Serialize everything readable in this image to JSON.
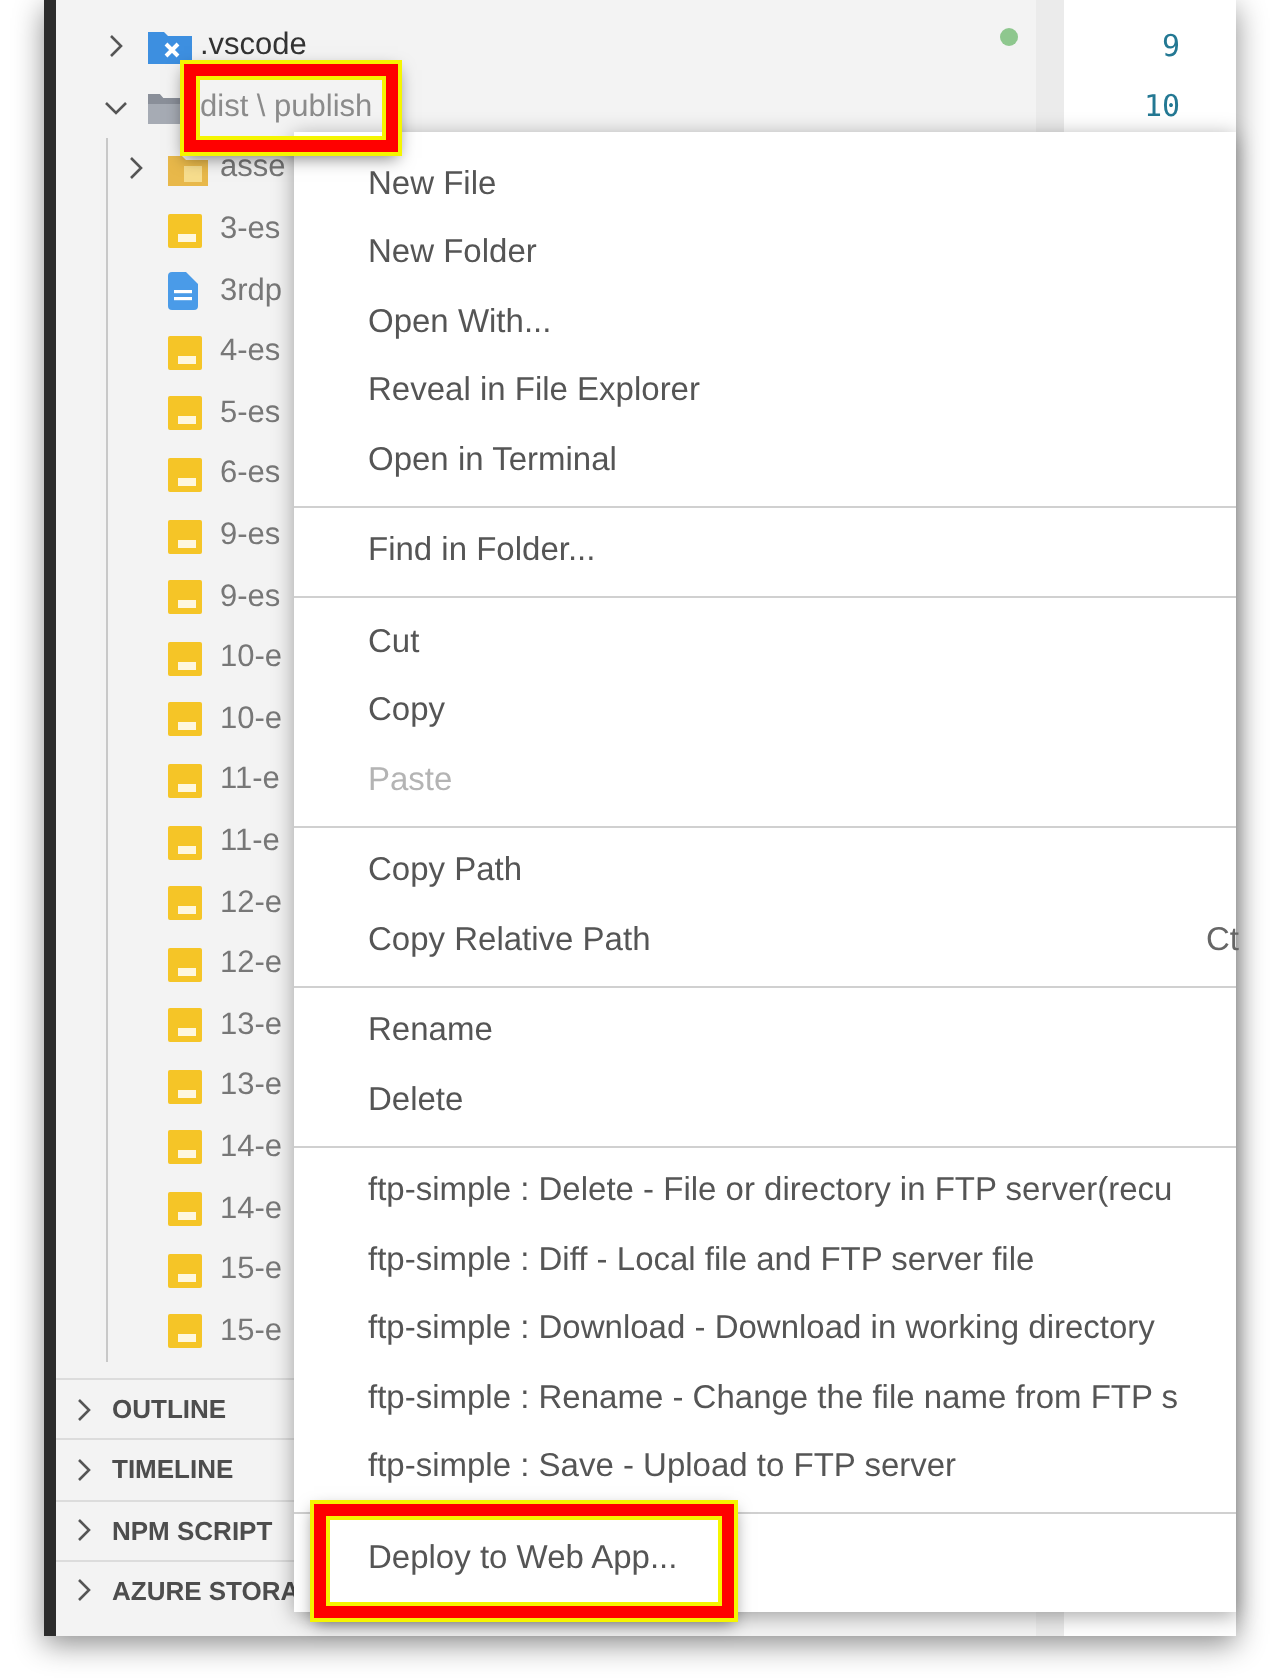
{
  "explorer": {
    "tree": [
      {
        "name": ".vscode",
        "kind": "vscode-folder",
        "expanded": false,
        "modified": true,
        "highlighted": false
      },
      {
        "name": "dist \\ publish",
        "kind": "folder",
        "expanded": true,
        "modified": false,
        "highlighted": true,
        "children": [
          {
            "name": "asse",
            "kind": "assets-folder",
            "expanded": false,
            "highlighted": false
          },
          {
            "name": "3-es",
            "kind": "js",
            "highlighted": false
          },
          {
            "name": "3rdp",
            "kind": "doc",
            "highlighted": false
          },
          {
            "name": "4-es",
            "kind": "js",
            "highlighted": false
          },
          {
            "name": "5-es",
            "kind": "js",
            "highlighted": false
          },
          {
            "name": "6-es",
            "kind": "js",
            "highlighted": false
          },
          {
            "name": "9-es",
            "kind": "js",
            "highlighted": false
          },
          {
            "name": "9-es",
            "kind": "js",
            "highlighted": false
          },
          {
            "name": "10-e",
            "kind": "js",
            "highlighted": false
          },
          {
            "name": "10-e",
            "kind": "js",
            "highlighted": false
          },
          {
            "name": "11-e",
            "kind": "js",
            "highlighted": false
          },
          {
            "name": "11-e",
            "kind": "js",
            "highlighted": false
          },
          {
            "name": "12-e",
            "kind": "js",
            "highlighted": false
          },
          {
            "name": "12-e",
            "kind": "js",
            "highlighted": false
          },
          {
            "name": "13-e",
            "kind": "js",
            "highlighted": false
          },
          {
            "name": "13-e",
            "kind": "js",
            "highlighted": false
          },
          {
            "name": "14-e",
            "kind": "js",
            "highlighted": false
          },
          {
            "name": "14-e",
            "kind": "js",
            "highlighted": false
          },
          {
            "name": "15-e",
            "kind": "js",
            "highlighted": false
          },
          {
            "name": "15-e",
            "kind": "js",
            "highlighted": false
          }
        ]
      }
    ]
  },
  "panels": [
    {
      "title": "OUTLINE",
      "expanded": false
    },
    {
      "title": "TIMELINE",
      "expanded": false
    },
    {
      "title": "NPM SCRIPT",
      "expanded": false
    },
    {
      "title": "AZURE STORA",
      "expanded": false
    }
  ],
  "editor": {
    "line_numbers": [
      "9",
      "10"
    ]
  },
  "context_menu": {
    "groups": [
      [
        {
          "label": "New File",
          "disabled": false,
          "highlighted": false
        },
        {
          "label": "New Folder",
          "disabled": false,
          "highlighted": false
        },
        {
          "label": "Open With...",
          "disabled": false,
          "highlighted": false
        },
        {
          "label": "Reveal in File Explorer",
          "disabled": false,
          "highlighted": false
        },
        {
          "label": "Open in Terminal",
          "disabled": false,
          "highlighted": false
        }
      ],
      [
        {
          "label": "Find in Folder...",
          "disabled": false,
          "highlighted": false
        }
      ],
      [
        {
          "label": "Cut",
          "disabled": false,
          "highlighted": false
        },
        {
          "label": "Copy",
          "disabled": false,
          "highlighted": false
        },
        {
          "label": "Paste",
          "disabled": true,
          "highlighted": false
        }
      ],
      [
        {
          "label": "Copy Path",
          "disabled": false,
          "highlighted": false
        },
        {
          "label": "Copy Relative Path",
          "shortcut": "Ct",
          "disabled": false,
          "highlighted": false
        }
      ],
      [
        {
          "label": "Rename",
          "disabled": false,
          "highlighted": false
        },
        {
          "label": "Delete",
          "disabled": false,
          "highlighted": false
        }
      ],
      [
        {
          "label": "ftp-simple : Delete - File or directory in FTP server(recu",
          "disabled": false,
          "highlighted": false
        },
        {
          "label": "ftp-simple : Diff - Local file and FTP server file",
          "disabled": false,
          "highlighted": false
        },
        {
          "label": "ftp-simple : Download - Download in working directory",
          "disabled": false,
          "highlighted": false
        },
        {
          "label": "ftp-simple : Rename - Change the file name from FTP s",
          "disabled": false,
          "highlighted": false
        },
        {
          "label": "ftp-simple : Save - Upload to FTP server",
          "disabled": false,
          "highlighted": false
        }
      ],
      [
        {
          "label": "Deploy to Web App...",
          "disabled": false,
          "highlighted": true
        }
      ]
    ]
  }
}
